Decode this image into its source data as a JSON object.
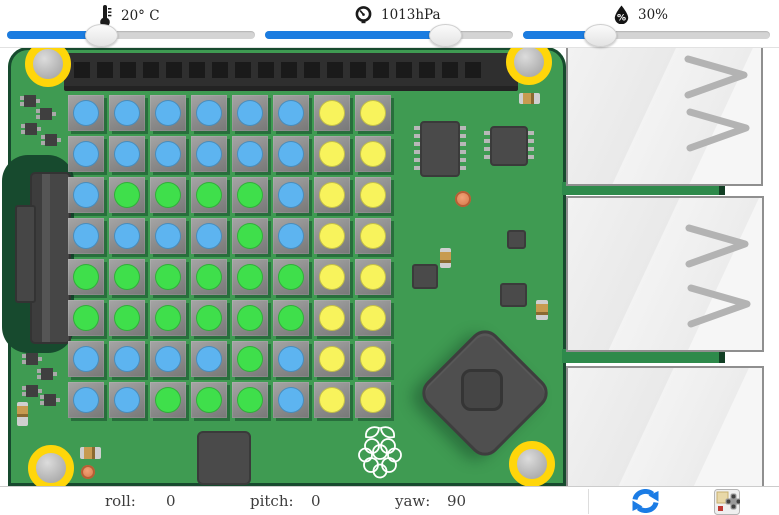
{
  "header": {
    "temperature": {
      "icon": "thermometer-icon",
      "label": "20° C",
      "percent": 38.7
    },
    "pressure": {
      "icon": "gauge-icon",
      "label": "1013hPa",
      "percent": 73.4
    },
    "humidity": {
      "icon": "droplet-icon",
      "label": "30%",
      "percent": 32
    }
  },
  "footer": {
    "roll_label": "roll:",
    "roll_value": "0",
    "pitch_label": "pitch:",
    "pitch_value": "0",
    "yaw_label": "yaw:",
    "yaw_value": "90"
  },
  "colors": {
    "accent_blue": "#1b7ce0",
    "board_green": "#3f9b52",
    "screw_ring_yellow": "#ffd60a",
    "led_blue": "#5db4f0",
    "led_green": "#3fdf4b",
    "led_yellow": "#f8f35c"
  },
  "led_matrix": {
    "rows": 8,
    "cols": 8,
    "palette": {
      "B": "#5db4f0",
      "G": "#3fdf4b",
      "Y": "#f8f35c"
    },
    "grid": [
      [
        "B",
        "B",
        "B",
        "B",
        "B",
        "B",
        "Y",
        "Y"
      ],
      [
        "B",
        "B",
        "B",
        "B",
        "B",
        "B",
        "Y",
        "Y"
      ],
      [
        "B",
        "G",
        "G",
        "G",
        "G",
        "B",
        "Y",
        "Y"
      ],
      [
        "B",
        "B",
        "B",
        "B",
        "G",
        "B",
        "Y",
        "Y"
      ],
      [
        "G",
        "G",
        "G",
        "G",
        "G",
        "G",
        "Y",
        "Y"
      ],
      [
        "G",
        "G",
        "G",
        "G",
        "G",
        "G",
        "Y",
        "Y"
      ],
      [
        "B",
        "B",
        "B",
        "B",
        "G",
        "B",
        "Y",
        "Y"
      ],
      [
        "B",
        "B",
        "G",
        "G",
        "G",
        "B",
        "Y",
        "Y"
      ]
    ]
  }
}
